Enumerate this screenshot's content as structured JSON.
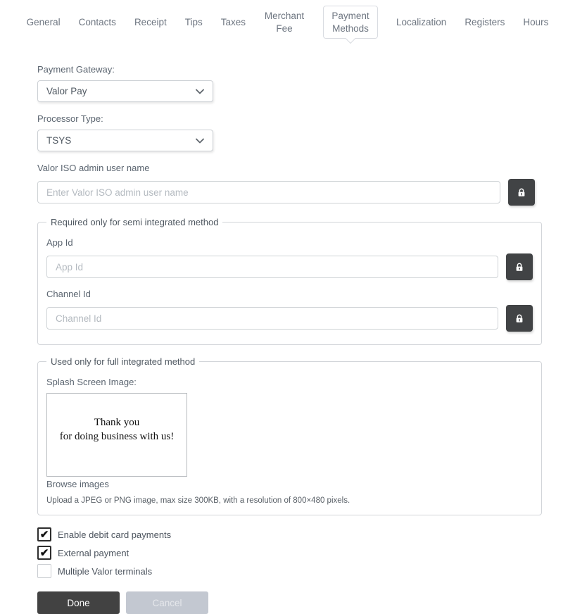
{
  "tabs": [
    {
      "label": "General"
    },
    {
      "label": "Contacts"
    },
    {
      "label": "Receipt"
    },
    {
      "label": "Tips"
    },
    {
      "label": "Taxes"
    },
    {
      "label": "Merchant Fee"
    },
    {
      "label": "Payment Methods"
    },
    {
      "label": "Localization"
    },
    {
      "label": "Registers"
    },
    {
      "label": "Hours"
    }
  ],
  "form": {
    "payment_gateway": {
      "label": "Payment Gateway:",
      "value": "Valor Pay"
    },
    "processor_type": {
      "label": "Processor Type:",
      "value": "TSYS"
    },
    "valor_iso_user": {
      "label": "Valor ISO admin user name",
      "placeholder": "Enter Valor ISO admin user name",
      "value": ""
    },
    "semi_integrated": {
      "legend": "Required only for semi integrated method",
      "app_id": {
        "label": "App Id",
        "placeholder": "App Id",
        "value": ""
      },
      "channel_id": {
        "label": "Channel Id",
        "placeholder": "Channel Id",
        "value": ""
      }
    },
    "full_integrated": {
      "legend": "Used only for full integrated method",
      "splash_label": "Splash Screen Image:",
      "splash_image_line1": "Thank you",
      "splash_image_line2": "for doing business with us!",
      "browse_label": "Browse images",
      "upload_note": "Upload a JPEG or PNG image, max size 300KB, with a resolution of 800×480 pixels."
    },
    "checkboxes": [
      {
        "label": "Enable debit card payments",
        "checked": true
      },
      {
        "label": "External payment",
        "checked": true
      },
      {
        "label": "Multiple Valor terminals",
        "checked": false
      }
    ]
  },
  "buttons": {
    "done": "Done",
    "cancel": "Cancel"
  },
  "icons": {
    "check_glyph": "✔",
    "lock": "lock-icon",
    "chevron_down": "chevron-down-icon"
  },
  "colors": {
    "dark_button": "#424242",
    "lock_button": "#414345",
    "cancel_button": "#c3c8d1",
    "tab_border": "#d9dce1",
    "label_text": "#5b6570"
  }
}
